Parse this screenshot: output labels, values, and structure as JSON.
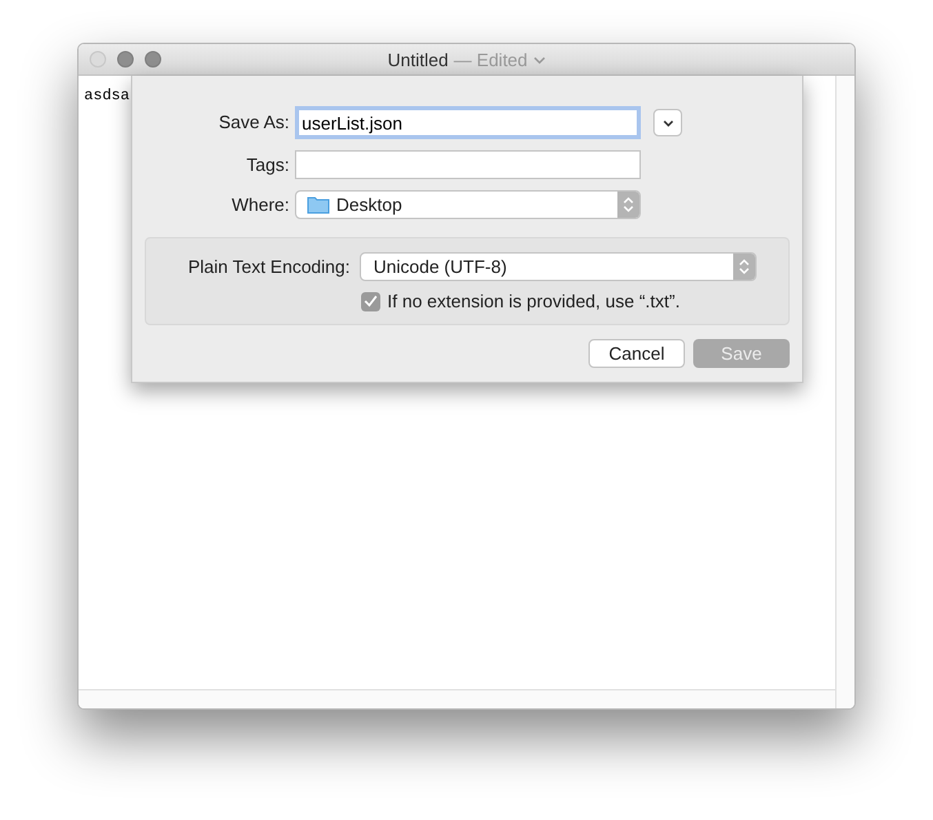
{
  "window": {
    "title": "Untitled",
    "subtitle": "— Edited"
  },
  "document": {
    "text": "asdsa"
  },
  "sheet": {
    "save_as": {
      "label": "Save As:",
      "value": "userList.json"
    },
    "tags": {
      "label": "Tags:"
    },
    "where": {
      "label": "Where:",
      "value": "Desktop"
    },
    "encoding": {
      "label": "Plain Text Encoding:",
      "value": "Unicode (UTF-8)"
    },
    "extension_checkbox": {
      "label": "If no extension is provided, use “.txt”.",
      "checked": true
    },
    "buttons": [
      {
        "label": "Cancel",
        "disabled": false
      },
      {
        "label": "Save",
        "disabled": true
      }
    ]
  }
}
